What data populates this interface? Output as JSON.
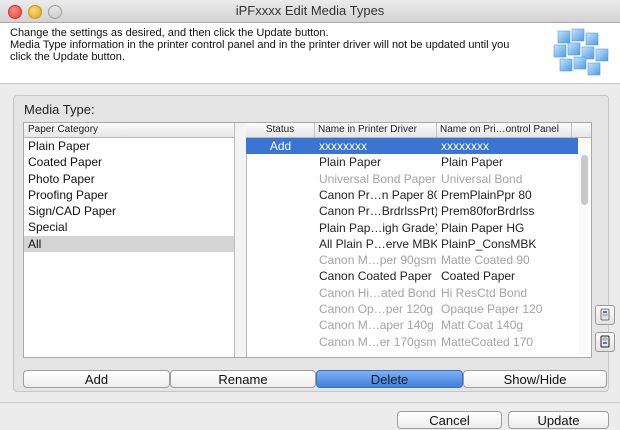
{
  "window": {
    "title": "iPFxxxx Edit Media Types"
  },
  "header": {
    "instructions": [
      "Change the settings as desired, and then click the Update button.",
      "Media Type information in the printer control panel and in the printer driver will not be updated until you",
      "click the Update button."
    ]
  },
  "media_type": {
    "label": "Media Type:",
    "category_header": "Paper Category",
    "categories": [
      "Plain Paper",
      "Coated Paper",
      "Photo Paper",
      "Proofing Paper",
      "Sign/CAD Paper",
      "Special",
      "All"
    ],
    "selected_category": "All",
    "table": {
      "columns": [
        "Status",
        "Name in Printer Driver",
        "Name on Pri…ontrol Panel"
      ],
      "rows": [
        {
          "status": "Add",
          "driver": "xxxxxxxx",
          "panel": "xxxxxxxx",
          "selected": true,
          "dim": false
        },
        {
          "status": "",
          "driver": "Plain Paper",
          "panel": "Plain Paper",
          "selected": false,
          "dim": false
        },
        {
          "status": "",
          "driver": "Universal Bond Paper",
          "panel": "Universal Bond",
          "selected": false,
          "dim": true
        },
        {
          "status": "",
          "driver": "Canon Pr…n Paper 80",
          "panel": "PremPlainPpr 80",
          "selected": false,
          "dim": false
        },
        {
          "status": "",
          "driver": "Canon Pr…BrdrlssPrt)",
          "panel": "Prem80forBrdrlss",
          "selected": false,
          "dim": false
        },
        {
          "status": "",
          "driver": "Plain Pap…igh Grade)",
          "panel": "Plain Paper HG",
          "selected": false,
          "dim": false
        },
        {
          "status": "",
          "driver": "All Plain P…erve MBK",
          "panel": "PlainP_ConsMBK",
          "selected": false,
          "dim": false
        },
        {
          "status": "",
          "driver": "Canon M…per 90gsm",
          "panel": "Matte Coated 90",
          "selected": false,
          "dim": true
        },
        {
          "status": "",
          "driver": "Canon Coated Paper",
          "panel": "Coated Paper",
          "selected": false,
          "dim": false
        },
        {
          "status": "",
          "driver": "Canon Hi…ated Bond",
          "panel": "Hi ResCtd Bond",
          "selected": false,
          "dim": true
        },
        {
          "status": "",
          "driver": "Canon Op…per 120g",
          "panel": "Opaque Paper 120",
          "selected": false,
          "dim": true
        },
        {
          "status": "",
          "driver": "Canon M…aper 140g",
          "panel": "Matt Coat 140g",
          "selected": false,
          "dim": true
        },
        {
          "status": "",
          "driver": "Canon M…er 170gsm",
          "panel": "MatteCoated 170",
          "selected": false,
          "dim": true
        }
      ]
    }
  },
  "buttons": {
    "add": "Add",
    "rename": "Rename",
    "delete": "Delete",
    "show_hide": "Show/Hide",
    "cancel": "Cancel",
    "update": "Update"
  },
  "colors": {
    "selection": "#3a75d4",
    "default_button": "#3d80de",
    "dim_text": "#a3a3a3"
  }
}
